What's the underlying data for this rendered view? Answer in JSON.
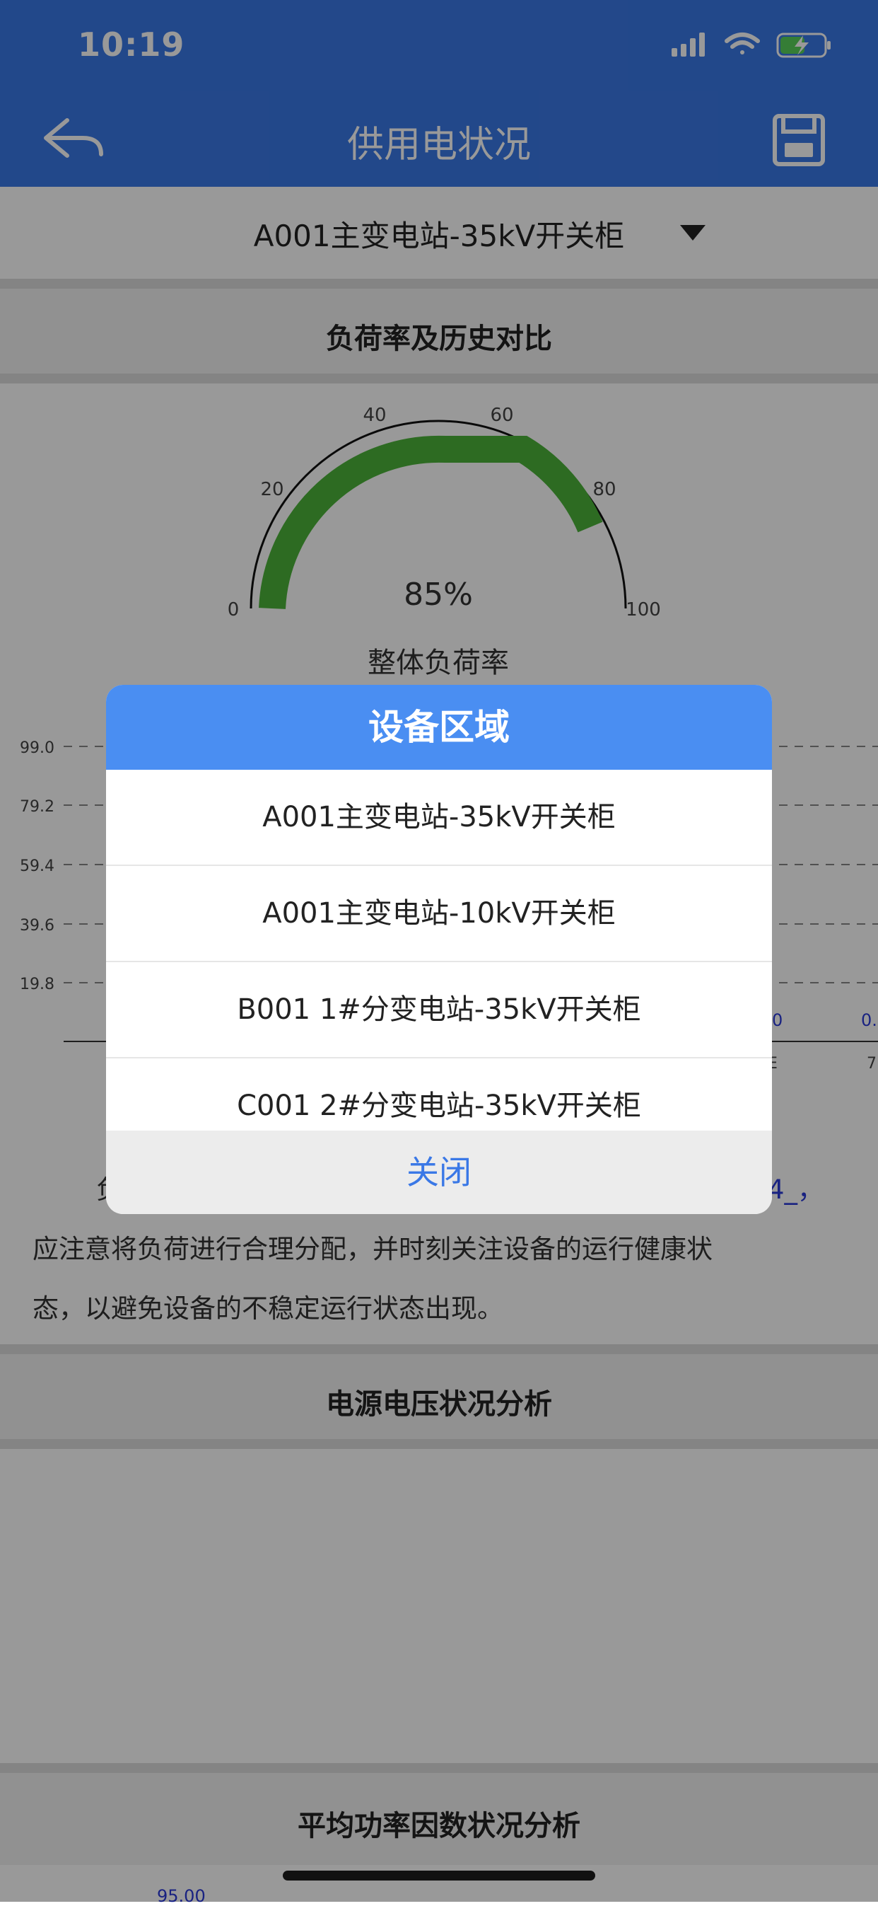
{
  "status_bar": {
    "time": "10:19"
  },
  "nav": {
    "title": "供用电状况",
    "back_icon": "back-arrow-icon",
    "save_icon": "save-icon"
  },
  "device_select": {
    "value": "A001主变电站-35kV开关柜"
  },
  "sections": {
    "load_rate": {
      "title": "负荷率及历史对比"
    },
    "voltage": {
      "title": "电源电压状况分析"
    },
    "power_factor": {
      "title": "平均功率因数状况分析"
    }
  },
  "gauge": {
    "center_value": "85%",
    "caption": "整体负荷率",
    "ticks": [
      "0",
      "20",
      "40",
      "60",
      "80",
      "100"
    ]
  },
  "chart_data": {
    "type": "line",
    "title": "",
    "yticks": [
      "99.0",
      "79.2",
      "59.4",
      "39.6",
      "19.8"
    ],
    "right_labels": [
      "0",
      "0."
    ],
    "bottom_labels": [
      "E",
      "7"
    ]
  },
  "description": {
    "fragment_left": "负",
    "fragment_right": "4_，",
    "line2": "应注意将负荷进行合理分配，并时刻关注设备的运行健康状",
    "line3": "态，以避免设备的不稳定运行状态出现。"
  },
  "bottom_partial": {
    "value": "95.00"
  },
  "modal": {
    "title": "设备区域",
    "options": [
      "A001主变电站-35kV开关柜",
      "A001主变电站-10kV开关柜",
      "B001 1#分变电站-35kV开关柜",
      "C001 2#分变电站-35kV开关柜"
    ],
    "close_label": "关闭"
  },
  "colors": {
    "header": "#3a78e6",
    "modal_header": "#4a8ef2",
    "gauge_fill": "#4bb33a",
    "accent": "#3a78e6"
  }
}
